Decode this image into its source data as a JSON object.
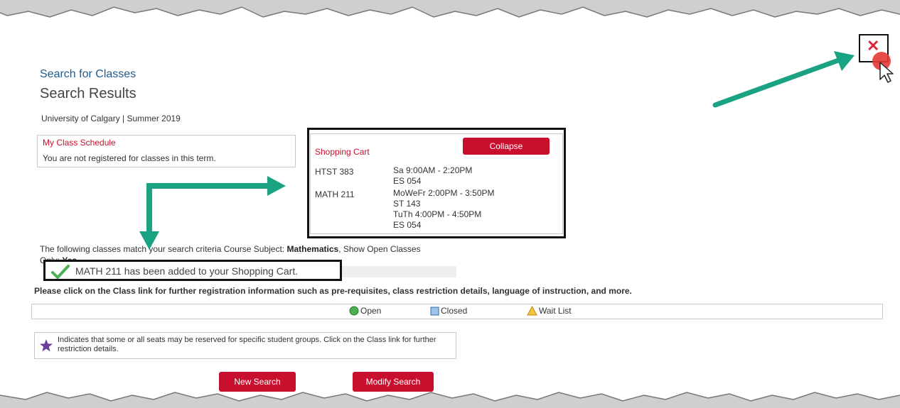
{
  "breadcrumb": "Search for Classes",
  "page_title": "Search Results",
  "term_info": "University of Calgary | Summer 2019",
  "my_schedule": {
    "title": "My Class Schedule",
    "message": "You are not registered for classes in this term."
  },
  "shopping_cart": {
    "title": "Shopping Cart",
    "collapse_label": "Collapse",
    "courses": [
      {
        "code": "HTST 383",
        "schedule_lines": [
          "Sa 9:00AM - 2:20PM",
          "ES 054"
        ]
      },
      {
        "code": "MATH 211",
        "schedule_lines": [
          "MoWeFr 2:00PM - 3:50PM",
          "ST 143",
          "TuTh 4:00PM - 4:50PM",
          "ES 054"
        ]
      }
    ]
  },
  "criteria": {
    "prefix": "The following classes match your search criteria Course Subject: ",
    "subject": "Mathematics",
    "middle": ",  Show Open Classes",
    "only_label": "Only: ",
    "only_value": "Yes"
  },
  "added_message": "MATH  211 has been added to your Shopping Cart.",
  "click_info": "Please click on the Class link for further registration information such as pre-requisites, class restriction details, language of instruction, and more.",
  "legend": {
    "open": "Open",
    "closed": "Closed",
    "waitlist": "Wait List"
  },
  "reserved_note": "Indicates that some or all seats may be reserved for specific student groups. Click on the Class link for further restriction details.",
  "buttons": {
    "new_search": "New Search",
    "modify_search": "Modify Search"
  },
  "close_symbol": "✕",
  "colors": {
    "accent_red": "#c8102e",
    "annotation_green": "#1aa383",
    "link_blue": "#1f5a8c"
  },
  "icons": [
    "close-icon",
    "mouse-cursor-icon",
    "checkmark-icon",
    "open-circle-icon",
    "closed-square-icon",
    "waitlist-triangle-icon",
    "reserved-star-icon"
  ]
}
